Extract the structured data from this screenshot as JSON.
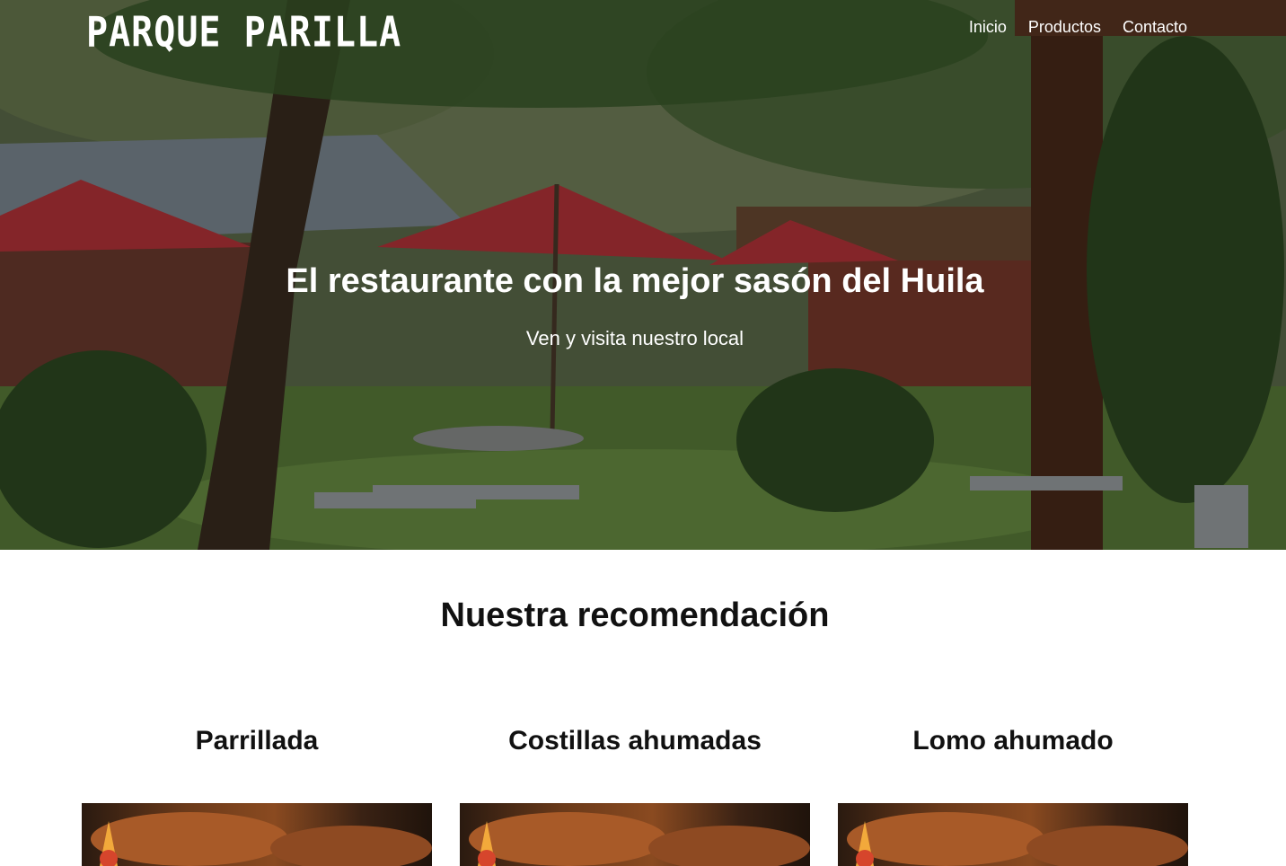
{
  "header": {
    "brand": "PARQUE PARILLA",
    "nav": [
      {
        "label": "Inicio"
      },
      {
        "label": "Productos"
      },
      {
        "label": "Contacto"
      }
    ]
  },
  "hero": {
    "title": "El restaurante con la mejor sasón del Huila",
    "subtitle": "Ven y visita nuestro local"
  },
  "recommendations": {
    "title": "Nuestra recomendación",
    "items": [
      {
        "name": "Parrillada"
      },
      {
        "name": "Costillas ahumadas"
      },
      {
        "name": "Lomo ahumado"
      }
    ]
  },
  "colors": {
    "hero_overlay": "#000000",
    "umbrella": "#b8343a",
    "text_light": "#ffffff",
    "text_dark": "#111111"
  }
}
